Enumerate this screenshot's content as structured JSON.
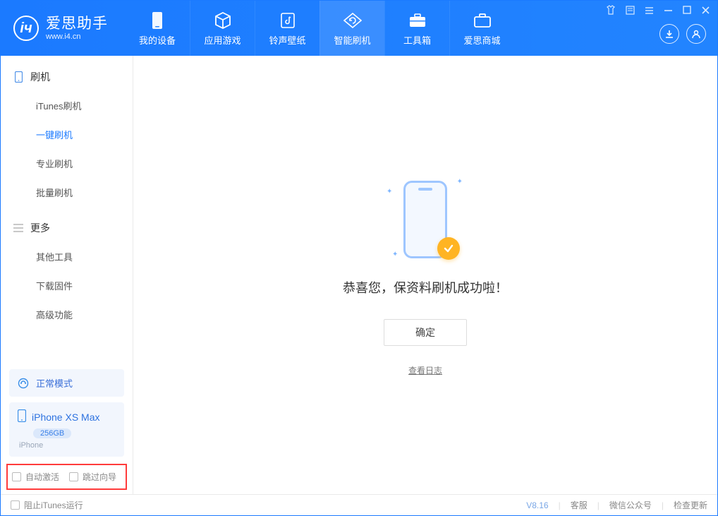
{
  "app": {
    "title": "爱思助手",
    "subtitle": "www.i4.cn"
  },
  "nav": {
    "items": [
      {
        "label": "我的设备",
        "icon": "device"
      },
      {
        "label": "应用游戏",
        "icon": "cube"
      },
      {
        "label": "铃声壁纸",
        "icon": "music"
      },
      {
        "label": "智能刷机",
        "icon": "refresh",
        "active": true
      },
      {
        "label": "工具箱",
        "icon": "toolbox"
      },
      {
        "label": "爱思商城",
        "icon": "briefcase"
      }
    ]
  },
  "sidebar": {
    "sections": [
      {
        "title": "刷机",
        "items": [
          "iTunes刷机",
          "一键刷机",
          "专业刷机",
          "批量刷机"
        ],
        "activeIndex": 1,
        "icon": "phone"
      },
      {
        "title": "更多",
        "items": [
          "其他工具",
          "下载固件",
          "高级功能"
        ],
        "activeIndex": -1,
        "icon": "menu"
      }
    ],
    "mode": "正常模式",
    "device": {
      "name": "iPhone XS Max",
      "capacity": "256GB",
      "type": "iPhone"
    },
    "checkboxes": {
      "autoActivate": "自动激活",
      "skipGuide": "跳过向导"
    }
  },
  "main": {
    "successText": "恭喜您，保资料刷机成功啦！",
    "okButton": "确定",
    "viewLog": "查看日志"
  },
  "footer": {
    "blockItunes": "阻止iTunes运行",
    "version": "V8.16",
    "links": [
      "客服",
      "微信公众号",
      "检查更新"
    ]
  }
}
